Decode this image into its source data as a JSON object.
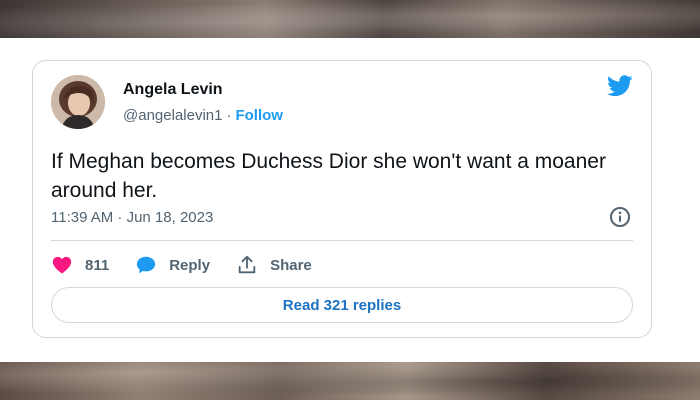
{
  "tweet": {
    "author_name": "Angela Levin",
    "handle": "@angelalevin1",
    "separator": "·",
    "follow_label": "Follow",
    "text": "If Meghan becomes Duchess Dior she won't want a moaner around her.",
    "timestamp": "11:39 AM · Jun 18, 2023",
    "likes": "811",
    "reply_label": "Reply",
    "share_label": "Share",
    "read_replies_label": "Read 321 replies"
  },
  "icons": {
    "brand": "twitter-bird-icon",
    "info": "info-icon",
    "like": "heart-icon",
    "reply": "speech-bubble-icon",
    "share": "share-upload-icon"
  },
  "colors": {
    "brand_blue": "#1d9bf0",
    "like_pink": "#f91880",
    "text": "#0f1419",
    "muted": "#536471",
    "border": "#cfd9de"
  }
}
